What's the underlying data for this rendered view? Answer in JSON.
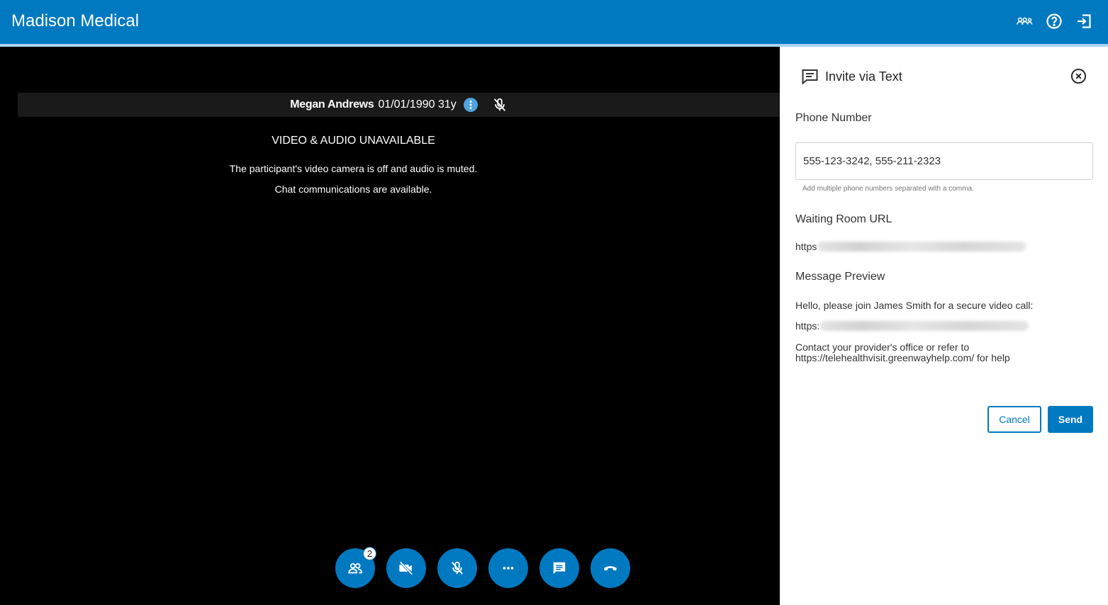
{
  "header": {
    "app_title": "Madison Medical",
    "icons": [
      "participants-icon",
      "help-icon",
      "logout-icon"
    ]
  },
  "participant": {
    "name": "Megan Andrews",
    "dob_age": "01/01/1990 31y"
  },
  "stage": {
    "unavailable_title": "VIDEO & AUDIO UNAVAILABLE",
    "message_line1": "The participant's video camera is off and audio is muted.",
    "message_line2": "Chat communications are available."
  },
  "controls": {
    "participants_count": "2",
    "buttons": [
      "participants-icon",
      "video-off-icon",
      "mic-off-icon",
      "more-icon",
      "chat-icon",
      "hang-up-icon"
    ]
  },
  "panel": {
    "title": "Invite via Text",
    "phone_label": "Phone Number",
    "phone_value": "555-123-3242, 555-211-2323",
    "phone_hint": "Add multiple phone numbers separated with a comma.",
    "url_label": "Waiting Room URL",
    "url_prefix": "https",
    "preview_label": "Message Preview",
    "preview_greeting": "Hello, please join James Smith for a secure video call:",
    "preview_url_prefix": "https:",
    "preview_help": "Contact your provider's office or refer to https://telehealthvisit.greenwayhelp.com/ for help",
    "cancel_label": "Cancel",
    "send_label": "Send"
  },
  "colors": {
    "brand": "#0079c1",
    "header_underline": "#a9d3ef",
    "stage_bg": "#000000"
  }
}
